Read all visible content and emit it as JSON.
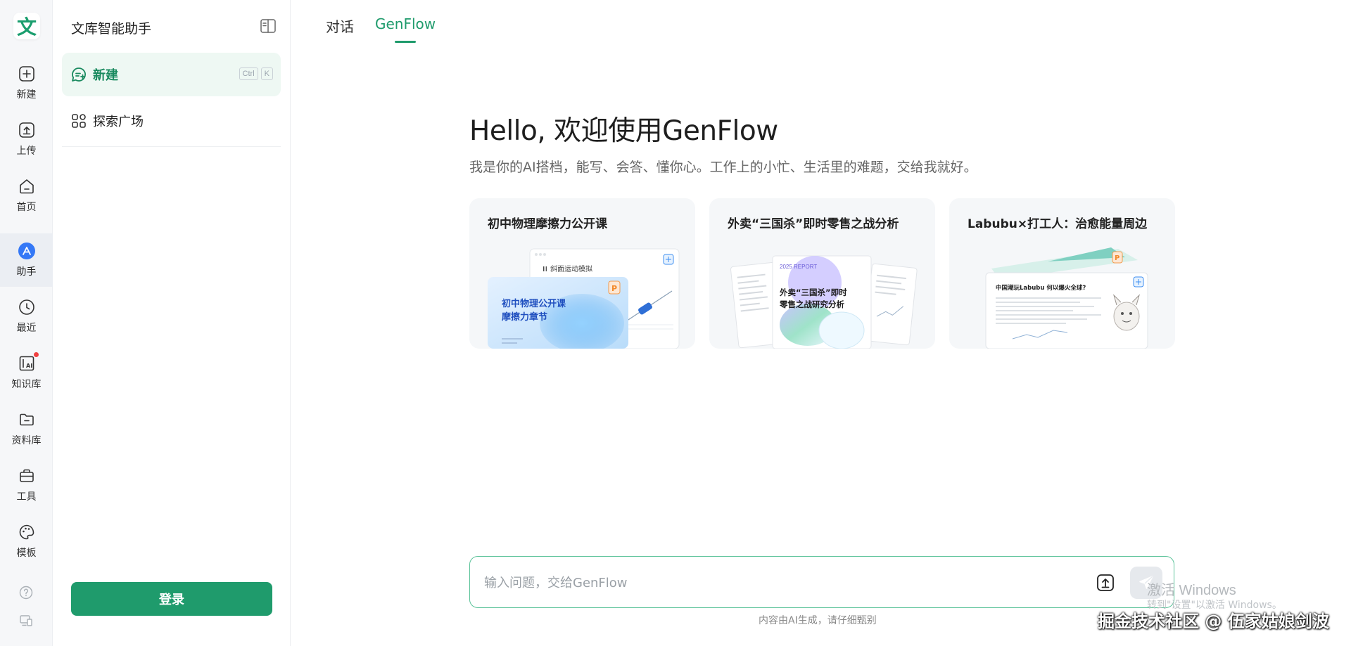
{
  "rail": {
    "logo_char": "文",
    "items": [
      {
        "label": "新建",
        "icon": "plus-icon"
      },
      {
        "label": "上传",
        "icon": "upload-icon"
      },
      {
        "label": "首页",
        "icon": "home-icon"
      },
      {
        "label": "助手",
        "icon": "assistant-icon"
      },
      {
        "label": "最近",
        "icon": "clock-icon"
      },
      {
        "label": "知识库",
        "icon": "knowledge-icon"
      },
      {
        "label": "资料库",
        "icon": "folder-icon"
      },
      {
        "label": "工具",
        "icon": "toolbox-icon"
      },
      {
        "label": "模板",
        "icon": "palette-icon"
      }
    ],
    "active_index": 3,
    "bottom_icons": [
      "help-icon",
      "device-icon"
    ]
  },
  "sidebar": {
    "title": "文库智能助手",
    "new_label": "新建",
    "shortcut": [
      "Ctrl",
      "K"
    ],
    "explore_label": "探索广场",
    "login_label": "登录"
  },
  "main": {
    "tabs": [
      {
        "label": "对话",
        "active": false
      },
      {
        "label": "GenFlow",
        "active": true
      }
    ],
    "heading": "Hello, 欢迎使用GenFlow",
    "subtitle": "我是你的AI搭档，能写、会答、懂你心。工作上的小忙、生活里的难题，交给我就好。",
    "cards": [
      {
        "title": "初中物理摩擦力公开课",
        "preview_line1": "初中物理公开课",
        "preview_line2": "摩擦力章节",
        "preview_doc_title": "斜面运动模拟"
      },
      {
        "title": "外卖“三国杀”即时零售之战分析",
        "preview_year": "2025 REPORT",
        "preview_line1": "外卖“三国杀”即时",
        "preview_line2": "零售之战研究分析"
      },
      {
        "title": "Labubu×打工人：治愈能量周边",
        "preview_doc_title": "中国潮玩Labubu  何以爆火全球?"
      }
    ],
    "input_placeholder": "输入问题，交给GenFlow",
    "disclaimer": "内容由AI生成，请仔细甄别"
  },
  "overlay": {
    "windows_title": "激活 Windows",
    "windows_sub": "转到\"设置\"以激活 Windows。",
    "watermark": "掘金技术社区 @ 伍家姑娘剑波"
  },
  "colors": {
    "brand": "#1f9b6c",
    "brand_light": "#eef8f3",
    "input_border": "#5cc39a"
  }
}
